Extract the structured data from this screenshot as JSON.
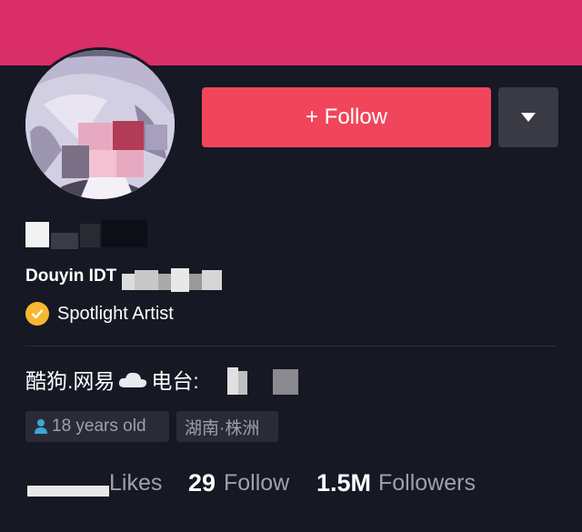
{
  "header": {
    "banner_color": "#d92e68"
  },
  "actions": {
    "follow_label": "+ Follow",
    "follow_color": "#f0455a",
    "more_icon": "caret-down-icon"
  },
  "profile": {
    "douyin_id_prefix": "Douyin IDT",
    "badge_label": "Spotlight Artist",
    "badge_icon": "check-badge-icon",
    "bio": {
      "part1": "酷狗.网易",
      "part2": "电台:"
    }
  },
  "tags": {
    "age": "18 years old",
    "location": "湖南·株洲"
  },
  "stats": {
    "likes_label": "Likes",
    "following_count": "29",
    "following_label": "Follow",
    "followers_count": "1.5M",
    "followers_label": "Followers"
  }
}
